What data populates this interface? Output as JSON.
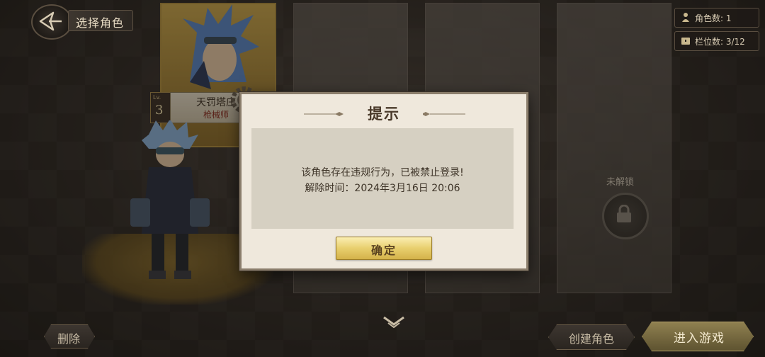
{
  "header": {
    "title": "选择角色"
  },
  "stats": {
    "role_count": "角色数: 1",
    "slot_count": "栏位数: 3/12"
  },
  "character": {
    "level_tag": "Lv.",
    "level": "3",
    "name": "天罚塔庄",
    "class": "枪械师"
  },
  "locked_slot": {
    "label": "未解锁"
  },
  "buttons": {
    "delete": "删除",
    "create": "创建角色",
    "enter": "进入游戏"
  },
  "dialog": {
    "title": "提示",
    "message_line1": "该角色存在违规行为，已被禁止登录!",
    "message_line2": "解除时间：2024年3月16日 20:06",
    "confirm": "确定"
  },
  "icons": {
    "back": "back-arrow-icon",
    "role": "person-icon",
    "slot": "chest-icon",
    "lock": "lock-icon",
    "gear": "gear-icon",
    "expand": "chevron-down-icon"
  },
  "colors": {
    "accent_gold": "#e8cf6e",
    "dialog_bg": "#efe8dc",
    "panel_bg": "#d6d0c2"
  }
}
